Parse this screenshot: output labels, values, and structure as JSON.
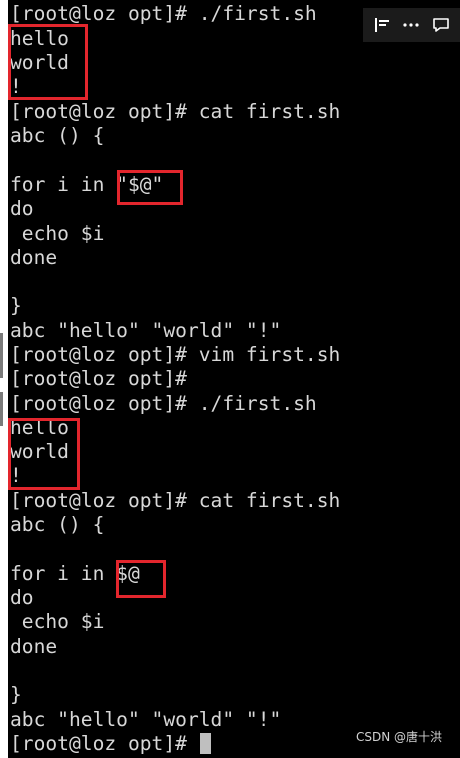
{
  "terminal": {
    "lines": [
      "[root@loz opt]# ./first.sh",
      "hello",
      "world",
      "!",
      "[root@loz opt]# cat first.sh",
      "abc () {",
      "",
      "for i in \"$@\"",
      "do",
      " echo $i",
      "done",
      "",
      "}",
      "abc \"hello\" \"world\" \"!\"",
      "[root@loz opt]# vim first.sh",
      "[root@loz opt]#",
      "[root@loz opt]# ./first.sh",
      "hello",
      "world",
      "!",
      "[root@loz opt]# cat first.sh",
      "abc () {",
      "",
      "for i in $@",
      "do",
      " echo $i",
      "done",
      "",
      "}",
      "abc \"hello\" \"world\" \"!\"",
      "[root@loz opt]# "
    ],
    "colors": {
      "background": "#000000",
      "text": "#d8d8d8",
      "cursor": "#bfbfbf",
      "highlight_box": "#e3262d"
    }
  },
  "toolbar": {
    "icons": [
      "align-left-icon",
      "more-icon",
      "comment-icon"
    ]
  },
  "watermark": {
    "text": "CSDN @唐十洪"
  }
}
